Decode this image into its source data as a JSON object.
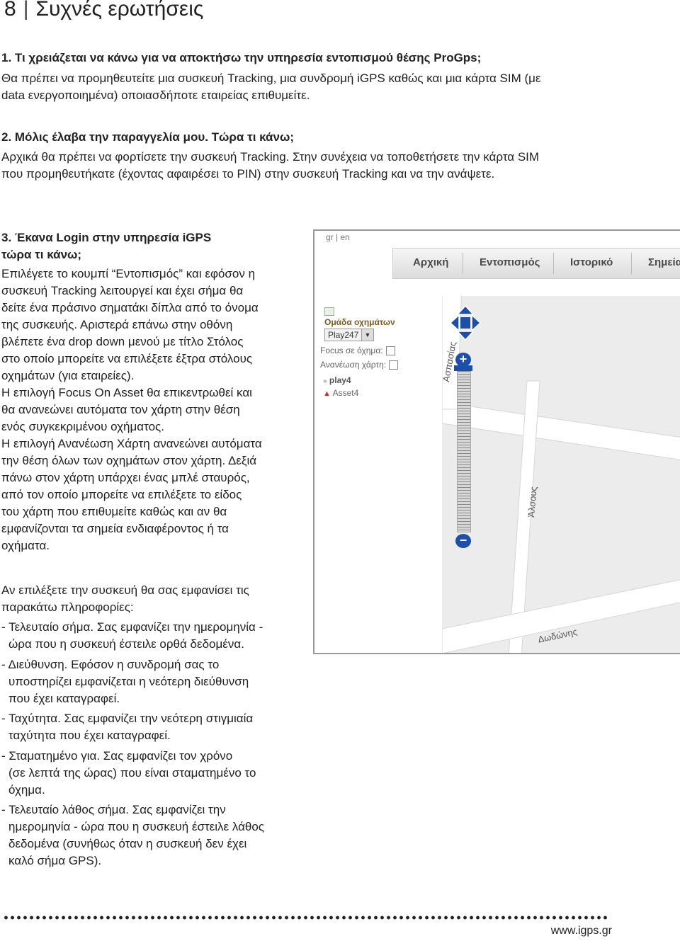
{
  "header": {
    "page_number": "8",
    "separator": "|",
    "title": "Συχνές ερωτήσεις"
  },
  "q1": {
    "question": "1. Τι χρειάζεται να κάνω για να αποκτήσω την υπηρεσία εντοπισμού θέσης ProGps;",
    "answer": [
      "Θα πρέπει να προμηθευτείτε μια  συσκευή Tracking, μια συνδρομή iGPS καθώς και μια κάρτα SIM (με",
      "data ενεργοποιημένα) οποιασδήποτε εταιρείας επιθυμείτε."
    ]
  },
  "q2": {
    "question": "2.  Μόλις έλαβα την παραγγελία μου. Τώρα τι κάνω;",
    "answer": [
      "Αρχικά θα πρέπει να φορτίσετε την συσκευή Tracking. Στην συνέχεια να τοποθετήσετε την κάρτα SIM",
      "που προμηθευτήκατε (έχοντας αφαιρέσει το PIN) στην συσκευή Tracking και να την ανάψετε."
    ]
  },
  "q3": {
    "question": [
      "3. Έκανα Login στην υπηρεσία iGPS",
      "τώρα τι κάνω;"
    ],
    "answer": [
      "Επιλέγετε το κουμπί “Εντοπισμός” και εφόσον η",
      "συσκευή Tracking λειτουργεί και έχει σήμα θα",
      "δείτε ένα πράσινο σηματάκι δίπλα από το όνομα",
      "της συσκευής. Αριστερά επάνω στην οθόνη",
      "βλέπετε ένα drop down μενού με τίτλο Στόλος",
      "στο οποίο μπορείτε να επιλέξετε έξτρα στόλους",
      "οχημάτων (για εταιρείες).",
      "Η επιλογή Focus On Asset θα επικεντρωθεί και",
      "θα ανανεώνει αυτόματα τον χάρτη στην θέση",
      "ενός συγκεκριμένου οχήματος.",
      "Η επιλογή Ανανέωση Χάρτη ανανεώνει αυτόματα",
      "την θέση όλων των οχημάτων στον χάρτη. Δεξιά",
      "πάνω στον χάρτη υπάρχει ένας μπλέ σταυρός,",
      "από τον οποίο μπορείτε να επιλέξετε το είδος",
      "του χάρτη που επιθυμείτε καθώς και αν θα",
      "εμφανίζονται τα σημεία ενδιαφέροντος ή τα",
      "οχήματα."
    ],
    "intro": [
      "Αν επιλέξετε την συσκευή θα σας εμφανίσει τις",
      "παρακάτω πληροφορίες:"
    ],
    "items": [
      [
        "- Τελευταίο σήμα. Σας εμφανίζει την ημερομηνία -",
        "ώρα που η συσκευή έστειλε ορθά δεδομένα."
      ],
      [
        "- Διεύθυνση. Εφόσον η συνδρομή σας το",
        "υποστηρίζει εμφανίζεται η νεότερη διεύθυνση",
        "που έχει καταγραφεί."
      ],
      [
        "- Ταχύτητα. Σας εμφανίζει την νεότερη στιγμιαία",
        "ταχύτητα που έχει καταγραφεί."
      ],
      [
        "- Σταματημένο για. Σας εμφανίζει τον χρόνο",
        "(σε λεπτά της ώρας) που είναι σταματημένο το",
        "όχημα."
      ],
      [
        "- Τελευταίο λάθος σήμα. Σας εμφανίζει την",
        "ημερομηνία - ώρα που η συσκευή έστειλε λάθος",
        "δεδομένα (συνήθως όταν η συσκευή δεν έχει",
        "καλό σήμα GPS)."
      ]
    ]
  },
  "screenshot": {
    "lang_gr": "gr",
    "lang_sep": "|",
    "lang_en": "en",
    "nav": [
      "Αρχική",
      "Εντοπισμός",
      "Ιστορικό",
      "Σημεία"
    ],
    "group_label": "Ομάδα οχημάτων",
    "group_value": "Play247",
    "focus_label": "Focus σε όχημα:",
    "refresh_label": "Ανανέωση χάρτη:",
    "vehicle_1": "play4",
    "vehicle_2": "Asset4",
    "streets": [
      "Ασπασίας",
      "Άλσους",
      "Δωδώνης"
    ],
    "colors": {
      "road": "#ffffff",
      "land": "#ececec",
      "nav_text": "#4a4a4a",
      "control_blue": "#1e4fa8"
    }
  },
  "footer": {
    "url": "www.igps.gr"
  }
}
